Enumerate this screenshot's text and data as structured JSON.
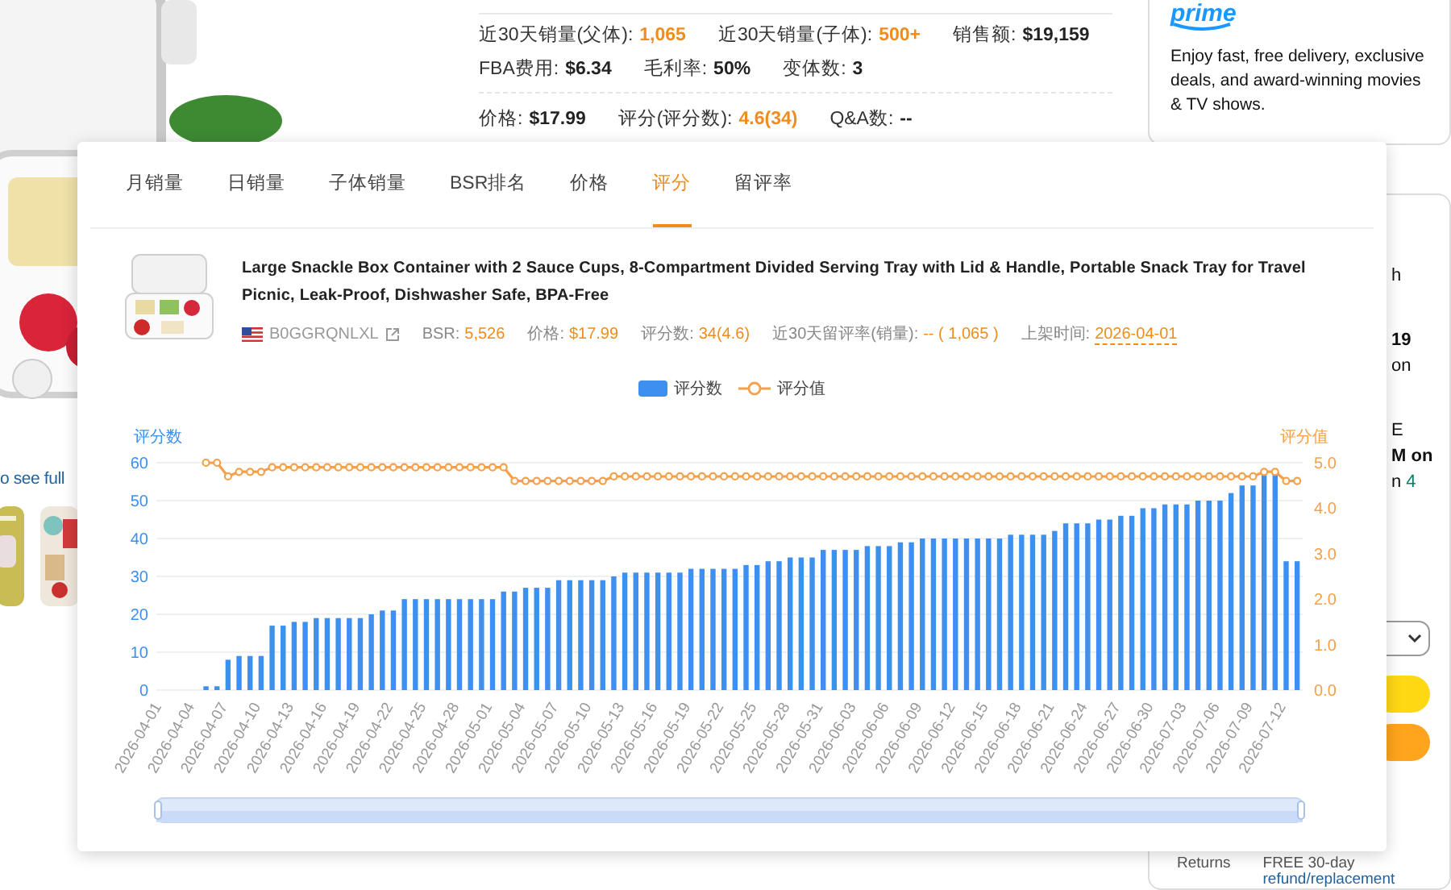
{
  "listing": {
    "see_full_link": "o see full"
  },
  "stats": [
    {
      "label": "近30天销量(父体):",
      "value": "1,065",
      "accent": true
    },
    {
      "label": "近30天销量(子体):",
      "value": "500+",
      "accent": true
    },
    {
      "label": "销售额:",
      "value": "$19,159",
      "accent": false
    },
    {
      "label": "FBA费用:",
      "value": "$6.34",
      "accent": false
    },
    {
      "label": "毛利率:",
      "value": "50%",
      "accent": false
    },
    {
      "label": "变体数:",
      "value": "3",
      "accent": false
    },
    {
      "label": "价格:",
      "value": "$17.99",
      "accent": false
    },
    {
      "label": "评分(评分数):",
      "value": "4.6(34)",
      "accent": true
    },
    {
      "label": "Q&A数:",
      "value": "--",
      "accent": false
    }
  ],
  "prime": {
    "logo": "prime",
    "text": "Enjoy fast, free delivery, exclusive deals, and award-winning movies & TV shows."
  },
  "buy_box": {
    "fragments": [
      {
        "text": "h",
        "bold": false
      },
      {
        "text": "19",
        "bold": true
      },
      {
        "text": "on",
        "bold": false
      },
      {
        "text": "E",
        "bold": false
      },
      {
        "text": "M on",
        "bold": true
      }
    ],
    "delivery_prefix": "n",
    "delivery_days": "4",
    "returns_label": "Returns",
    "returns_text": "FREE 30-day",
    "returns_link": "refund/replacement"
  },
  "popup": {
    "tabs": [
      {
        "label": "月销量",
        "selected": false
      },
      {
        "label": "日销量",
        "selected": false
      },
      {
        "label": "子体销量",
        "selected": false
      },
      {
        "label": "BSR排名",
        "selected": false
      },
      {
        "label": "价格",
        "selected": false
      },
      {
        "label": "评分",
        "selected": true
      },
      {
        "label": "留评率",
        "selected": false
      }
    ],
    "product": {
      "title": "Large Snackle Box Container with 2 Sauce Cups, 8-Compartment Divided Serving Tray with Lid & Handle, Portable Snack Tray for Travel Picnic, Leak-Proof, Dishwasher Safe, BPA-Free",
      "asin": "B0GGRQNLXL",
      "stats": [
        {
          "label": "BSR:",
          "value": "5,526"
        },
        {
          "label": "价格:",
          "value": "$17.99"
        },
        {
          "label": "评分数:",
          "value": "34(4.6)"
        },
        {
          "label": "近30天留评率(销量):",
          "value": "-- ( 1,065 )"
        },
        {
          "label": "上架时间:",
          "value": "2026-04-01"
        }
      ]
    },
    "chart_data": {
      "type": "bar",
      "grid": true,
      "ylabel": "评分数",
      "y2label": "评分值",
      "ylim": [
        0,
        60
      ],
      "y2lim": [
        0,
        5
      ],
      "yticks": [
        0,
        10,
        20,
        30,
        40,
        50,
        60
      ],
      "y2ticks": [
        {
          "value": 0,
          "label": "0.0"
        },
        {
          "value": 1,
          "label": "1.0"
        },
        {
          "value": 2,
          "label": "2.0"
        },
        {
          "value": 3,
          "label": "3.0"
        },
        {
          "value": 4,
          "label": "4.0"
        },
        {
          "value": 5,
          "label": "5.0"
        }
      ],
      "categories": [
        "2026-04-01",
        null,
        null,
        "2026-04-04",
        null,
        null,
        "2026-04-07",
        null,
        null,
        "2026-04-10",
        null,
        null,
        "2026-04-13",
        null,
        null,
        "2026-04-16",
        null,
        null,
        "2026-04-19",
        null,
        null,
        "2026-04-22",
        null,
        null,
        "2026-04-25",
        null,
        null,
        "2026-04-28",
        null,
        null,
        "2026-05-01",
        null,
        null,
        "2026-05-04",
        null,
        null,
        "2026-05-07",
        null,
        null,
        "2026-05-10",
        null,
        null,
        "2026-05-13",
        null,
        null,
        "2026-05-16",
        null,
        null,
        "2026-05-19",
        null,
        null,
        "2026-05-22",
        null,
        null,
        "2026-05-25",
        null,
        null,
        "2026-05-28",
        null,
        null,
        "2026-05-31",
        null,
        null,
        "2026-06-03",
        null,
        null,
        "2026-06-06",
        null,
        null,
        "2026-06-09",
        null,
        null,
        "2026-06-12",
        null,
        null,
        "2026-06-15",
        null,
        null,
        "2026-06-18",
        null,
        null,
        "2026-06-21",
        null,
        null,
        "2026-06-24",
        null,
        null,
        "2026-06-27",
        null,
        null,
        "2026-06-30",
        null,
        null,
        "2026-07-03",
        null,
        null,
        "2026-07-06",
        null,
        null,
        "2026-07-09",
        null,
        null,
        "2026-07-12",
        null
      ],
      "series": [
        {
          "name": "评分数",
          "color": "#3d8ff0",
          "values": [
            null,
            null,
            null,
            null,
            1,
            1,
            8,
            9,
            9,
            9,
            17,
            17,
            18,
            18,
            19,
            19,
            19,
            19,
            19,
            20,
            21,
            21,
            24,
            24,
            24,
            24,
            24,
            24,
            24,
            24,
            24,
            26,
            26,
            27,
            27,
            27,
            29,
            29,
            29,
            29,
            29,
            30,
            31,
            31,
            31,
            31,
            31,
            31,
            32,
            32,
            32,
            32,
            32,
            33,
            33,
            34,
            34,
            35,
            35,
            35,
            37,
            37,
            37,
            37,
            38,
            38,
            38,
            39,
            39,
            40,
            40,
            40,
            40,
            40,
            40,
            40,
            40,
            41,
            41,
            41,
            41,
            42,
            44,
            44,
            44,
            45,
            45,
            46,
            46,
            48,
            48,
            49,
            49,
            49,
            50,
            50,
            50,
            52,
            54,
            54,
            57,
            57,
            34,
            34
          ]
        },
        {
          "name": "评分值",
          "type": "line",
          "marker": "circle",
          "axis": "y2",
          "color": "#f5a04a",
          "values": [
            null,
            null,
            null,
            null,
            5.0,
            5.0,
            4.7,
            4.8,
            4.8,
            4.8,
            4.9,
            4.9,
            4.9,
            4.9,
            4.9,
            4.9,
            4.9,
            4.9,
            4.9,
            4.9,
            4.9,
            4.9,
            4.9,
            4.9,
            4.9,
            4.9,
            4.9,
            4.9,
            4.9,
            4.9,
            4.9,
            4.9,
            4.6,
            4.6,
            4.6,
            4.6,
            4.6,
            4.6,
            4.6,
            4.6,
            4.6,
            4.7,
            4.7,
            4.7,
            4.7,
            4.7,
            4.7,
            4.7,
            4.7,
            4.7,
            4.7,
            4.7,
            4.7,
            4.7,
            4.7,
            4.7,
            4.7,
            4.7,
            4.7,
            4.7,
            4.7,
            4.7,
            4.7,
            4.7,
            4.7,
            4.7,
            4.7,
            4.7,
            4.7,
            4.7,
            4.7,
            4.7,
            4.7,
            4.7,
            4.7,
            4.7,
            4.7,
            4.7,
            4.7,
            4.7,
            4.7,
            4.7,
            4.7,
            4.7,
            4.7,
            4.7,
            4.7,
            4.7,
            4.7,
            4.7,
            4.7,
            4.7,
            4.7,
            4.7,
            4.7,
            4.7,
            4.7,
            4.7,
            4.7,
            4.7,
            4.8,
            4.8,
            4.6,
            4.6
          ]
        }
      ]
    }
  }
}
